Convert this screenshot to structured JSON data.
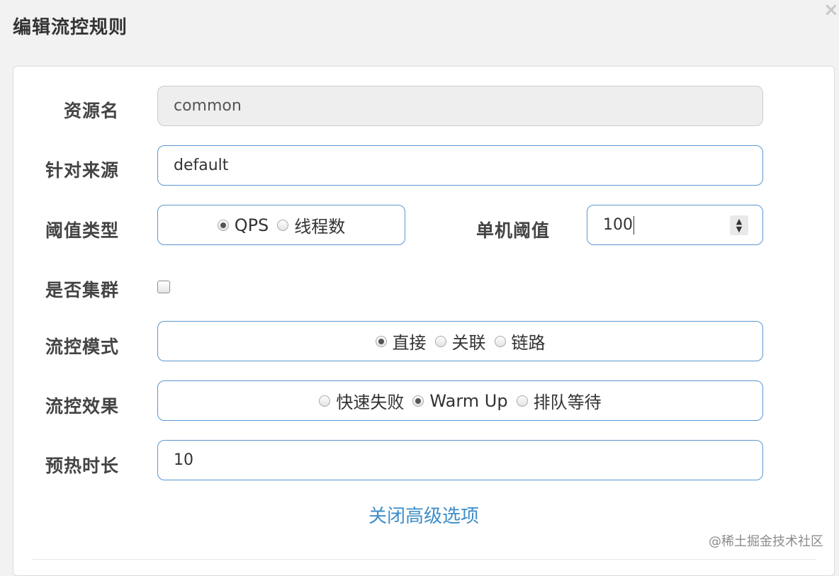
{
  "dialog": {
    "title": "编辑流控规则",
    "close_label": "×"
  },
  "form": {
    "resource_name": {
      "label": "资源名",
      "value": "common"
    },
    "limit_app": {
      "label": "针对来源",
      "value": "default"
    },
    "threshold_type": {
      "label": "阈值类型",
      "options": [
        {
          "label": "QPS",
          "checked": true
        },
        {
          "label": "线程数",
          "checked": false
        }
      ]
    },
    "single_threshold": {
      "label": "单机阈值",
      "value": "100"
    },
    "cluster": {
      "label": "是否集群",
      "checked": false
    },
    "flow_mode": {
      "label": "流控模式",
      "options": [
        {
          "label": "直接",
          "checked": true
        },
        {
          "label": "关联",
          "checked": false
        },
        {
          "label": "链路",
          "checked": false
        }
      ]
    },
    "flow_effect": {
      "label": "流控效果",
      "options": [
        {
          "label": "快速失败",
          "checked": false
        },
        {
          "label": "Warm Up",
          "checked": true
        },
        {
          "label": "排队等待",
          "checked": false
        }
      ]
    },
    "warmup_period": {
      "label": "预热时长",
      "value": "10"
    },
    "advanced_toggle": "关闭高级选项"
  },
  "watermark": "@稀土掘金技术社区",
  "colors": {
    "accent": "#3c8dc9",
    "input_border": "#5b97cf",
    "background": "#f2f2f2"
  }
}
